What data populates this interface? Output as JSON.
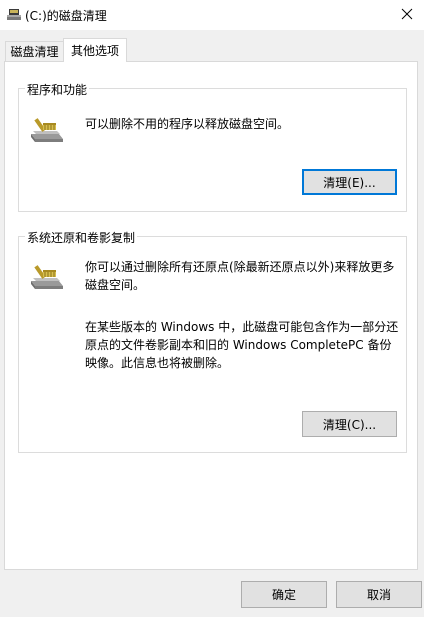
{
  "window": {
    "title": "(C:)的磁盘清理",
    "close_glyph": "✕"
  },
  "tabs": [
    {
      "label": "磁盘清理",
      "active": false
    },
    {
      "label": "其他选项",
      "active": true
    }
  ],
  "programs_group": {
    "legend": "程序和功能",
    "description": "可以删除不用的程序以释放磁盘空间。",
    "button_label": "清理(E)...",
    "icon": "disk-cleanup-icon"
  },
  "restore_group": {
    "legend": "系统还原和卷影复制",
    "paragraph1_line1": "你可以通过删除所有还原点(除最新还原点以外)来释放更多",
    "paragraph1_line2": "磁盘空间。",
    "paragraph2_line1": "在某些版本的 Windows 中，此磁盘可能包含作为一部分还",
    "paragraph2_line2": "原点的文件卷影副本和旧的 Windows CompletePC 备份",
    "paragraph2_line3": "映像。此信息也将被删除。",
    "button_label": "清理(C)...",
    "icon": "disk-cleanup-icon"
  },
  "footer": {
    "ok_label": "确定",
    "cancel_label": "取消"
  },
  "colors": {
    "focus_accent": "#0078d7",
    "window_bg": "#f0f0f0",
    "panel_bg": "#ffffff"
  }
}
